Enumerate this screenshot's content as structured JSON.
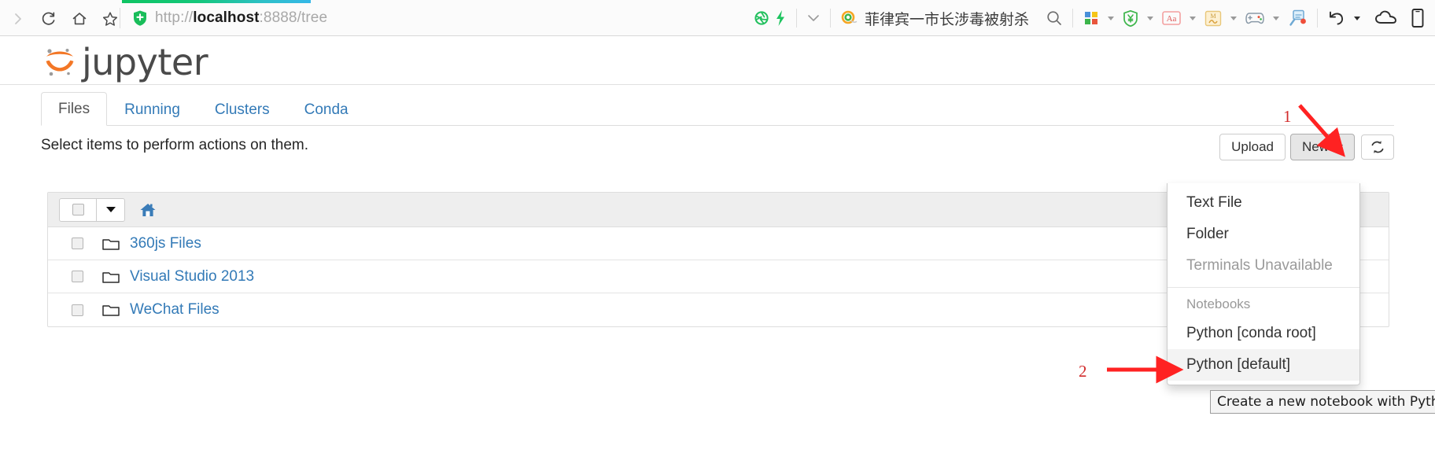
{
  "browser": {
    "url_prefix": "http://",
    "url_host": "localhost",
    "url_suffix": ":8888/tree",
    "search_term": "菲律宾一市长涉毒被射杀",
    "icons": {
      "forward": "forward-arrow-icon",
      "reload": "reload-icon",
      "home": "home-icon",
      "bookmark": "star-icon",
      "security": "shield-icon",
      "adblock": "aperture-icon",
      "speed": "lightning-bolt-icon",
      "search": "search-icon",
      "apps": "apps-grid-icon",
      "wallet": "wallet-shield-icon",
      "translate": "translate-icon",
      "skin": "skin-icon",
      "game": "game-icon",
      "capture": "screenshot-icon",
      "undo": "undo-icon",
      "cloud": "cloud-icon",
      "mobile": "mobile-icon"
    }
  },
  "header": {
    "logo_text": "jupyter"
  },
  "tabs": [
    {
      "label": "Files",
      "active": true
    },
    {
      "label": "Running",
      "active": false
    },
    {
      "label": "Clusters",
      "active": false
    },
    {
      "label": "Conda",
      "active": false
    }
  ],
  "actions": {
    "select_hint": "Select items to perform actions on them.",
    "upload_label": "Upload",
    "new_label": "New",
    "refresh_icon": "refresh-icon"
  },
  "file_list": {
    "header": {
      "select_all_checkbox": "",
      "dropdown_caret": "",
      "breadcrumb_icon": "home-icon"
    },
    "rows": [
      {
        "name": "360js Files",
        "icon": "folder-icon"
      },
      {
        "name": "Visual Studio 2013",
        "icon": "folder-icon"
      },
      {
        "name": "WeChat Files",
        "icon": "folder-icon"
      }
    ]
  },
  "new_menu": {
    "items": [
      {
        "label": "Text File",
        "state": "normal"
      },
      {
        "label": "Folder",
        "state": "normal"
      },
      {
        "label": "Terminals Unavailable",
        "state": "disabled"
      }
    ],
    "section_header": "Notebooks",
    "notebooks": [
      {
        "label": "Python [conda root]",
        "state": "normal"
      },
      {
        "label": "Python [default]",
        "state": "highlight"
      }
    ]
  },
  "tooltip": {
    "text": "Create a new notebook with Python [default]"
  },
  "annotations": [
    {
      "label": "1"
    },
    {
      "label": "2"
    }
  ],
  "colors": {
    "accent_link": "#337ab7",
    "annotation_red": "#d22b2b",
    "jupyter_orange": "#f37726",
    "progress_green": "#0fc463"
  }
}
